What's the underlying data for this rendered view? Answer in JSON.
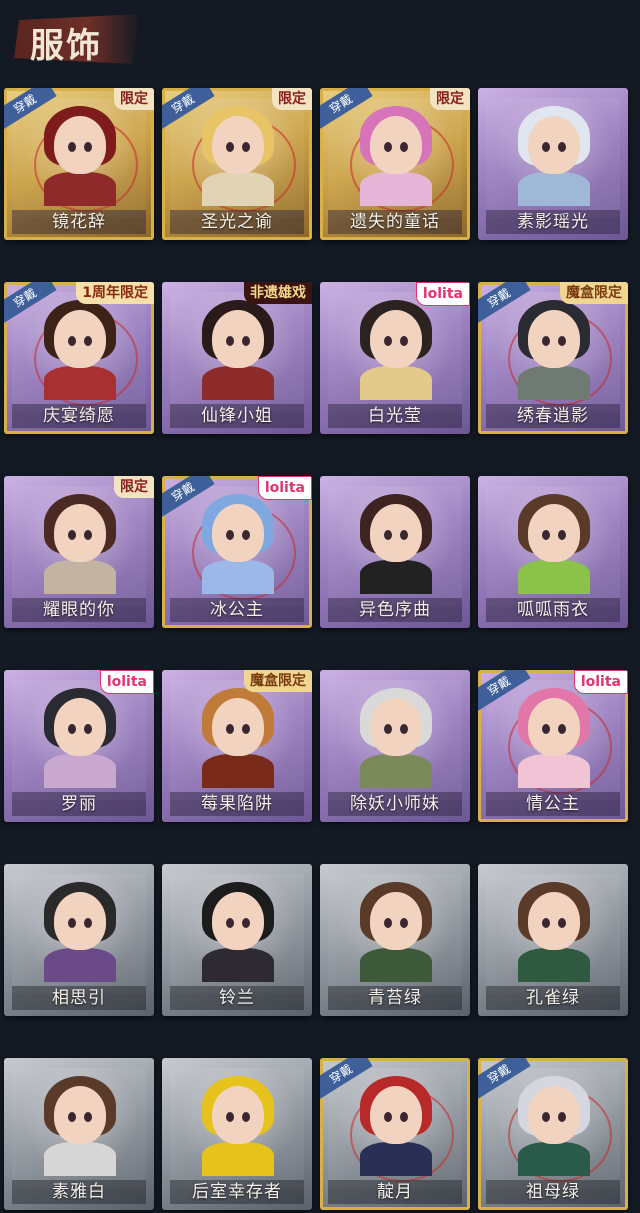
{
  "header": {
    "title": "服饰"
  },
  "tags": {
    "worn": "穿戴"
  },
  "cards": [
    {
      "name": "镜花辞",
      "theme": "worn gold",
      "worn": true,
      "corner": "限定",
      "corner_type": "limited",
      "hair": "#7e1b1b",
      "cloth": "#8e2a2a"
    },
    {
      "name": "圣光之谕",
      "theme": "worn gold",
      "worn": true,
      "corner": "限定",
      "corner_type": "limited",
      "hair": "#e7c466",
      "cloth": "#e0d4b4"
    },
    {
      "name": "遗失的童话",
      "theme": "worn gold",
      "worn": true,
      "corner": "限定",
      "corner_type": "limited",
      "hair": "#d773b8",
      "cloth": "#e6b6d8"
    },
    {
      "name": "素影瑶光",
      "theme": "purple",
      "worn": false,
      "corner": "",
      "corner_type": "",
      "hair": "#dfe6ef",
      "cloth": "#9fb8d8"
    },
    {
      "name": "庆宴绮愿",
      "theme": "purple worn",
      "worn": true,
      "corner": "1周年限定",
      "corner_type": "anniv",
      "hair": "#3d2218",
      "cloth": "#a83030"
    },
    {
      "name": "仙锋小姐",
      "theme": "purple",
      "worn": false,
      "corner": "非遗雄戏",
      "corner_type": "heritage",
      "hair": "#2a1a1a",
      "cloth": "#8d2b2b"
    },
    {
      "name": "白光莹",
      "theme": "purple",
      "worn": false,
      "corner": "lolita",
      "corner_type": "lolita",
      "hair": "#2c2220",
      "cloth": "#e3c98a"
    },
    {
      "name": "绣春逍影",
      "theme": "purple worn",
      "worn": true,
      "corner": "魔盒限定",
      "corner_type": "box",
      "hair": "#2b2b33",
      "cloth": "#6f7a72"
    },
    {
      "name": "耀眼的你",
      "theme": "purple",
      "worn": false,
      "corner": "限定",
      "corner_type": "limited",
      "hair": "#4a2a22",
      "cloth": "#c4b3a3"
    },
    {
      "name": "冰公主",
      "theme": "purple worn",
      "worn": true,
      "corner": "lolita",
      "corner_type": "lolita",
      "hair": "#7fa8e0",
      "cloth": "#9cb8e8"
    },
    {
      "name": "异色序曲",
      "theme": "purple",
      "worn": false,
      "corner": "",
      "corner_type": "",
      "hair": "#3d2420",
      "cloth": "#222"
    },
    {
      "name": "呱呱雨衣",
      "theme": "purple",
      "worn": false,
      "corner": "",
      "corner_type": "",
      "hair": "#5a3a28",
      "cloth": "#8ac24a"
    },
    {
      "name": "罗丽",
      "theme": "purple",
      "worn": false,
      "corner": "lolita",
      "corner_type": "lolita",
      "hair": "#2a2a33",
      "cloth": "#c9a8d0"
    },
    {
      "name": "莓果陷阱",
      "theme": "purple",
      "worn": false,
      "corner": "魔盒限定",
      "corner_type": "box",
      "hair": "#c07a3a",
      "cloth": "#7a2a1a"
    },
    {
      "name": "除妖小师妹",
      "theme": "purple",
      "worn": false,
      "corner": "",
      "corner_type": "",
      "hair": "#d9d9d9",
      "cloth": "#7a8a5a"
    },
    {
      "name": "情公主",
      "theme": "purple worn",
      "worn": true,
      "corner": "lolita",
      "corner_type": "lolita",
      "hair": "#e276a8",
      "cloth": "#f0c4d4"
    },
    {
      "name": "相思引",
      "theme": "grey",
      "worn": false,
      "corner": "",
      "corner_type": "",
      "hair": "#2a2a2a",
      "cloth": "#6b4a8a"
    },
    {
      "name": "铃兰",
      "theme": "grey",
      "worn": false,
      "corner": "",
      "corner_type": "",
      "hair": "#1c1c1c",
      "cloth": "#2e2a33"
    },
    {
      "name": "青苔绿",
      "theme": "grey",
      "worn": false,
      "corner": "",
      "corner_type": "",
      "hair": "#5a3a28",
      "cloth": "#3e5a3a"
    },
    {
      "name": "孔雀绿",
      "theme": "grey",
      "worn": false,
      "corner": "",
      "corner_type": "",
      "hair": "#5a3a28",
      "cloth": "#2f5a3f"
    },
    {
      "name": "素雅白",
      "theme": "grey",
      "worn": false,
      "corner": "",
      "corner_type": "",
      "hair": "#5a3a28",
      "cloth": "#d6d6d6"
    },
    {
      "name": "后室幸存者",
      "theme": "grey",
      "worn": false,
      "corner": "",
      "corner_type": "",
      "hair": "#e6c21c",
      "cloth": "#e6c21c"
    },
    {
      "name": "靛月",
      "theme": "grey worn",
      "worn": true,
      "corner": "",
      "corner_type": "",
      "hair": "#b82a2a",
      "cloth": "#2a2f55"
    },
    {
      "name": "祖母绿",
      "theme": "grey worn",
      "worn": true,
      "corner": "",
      "corner_type": "",
      "hair": "#d6d6e0",
      "cloth": "#2a5a4a"
    }
  ]
}
